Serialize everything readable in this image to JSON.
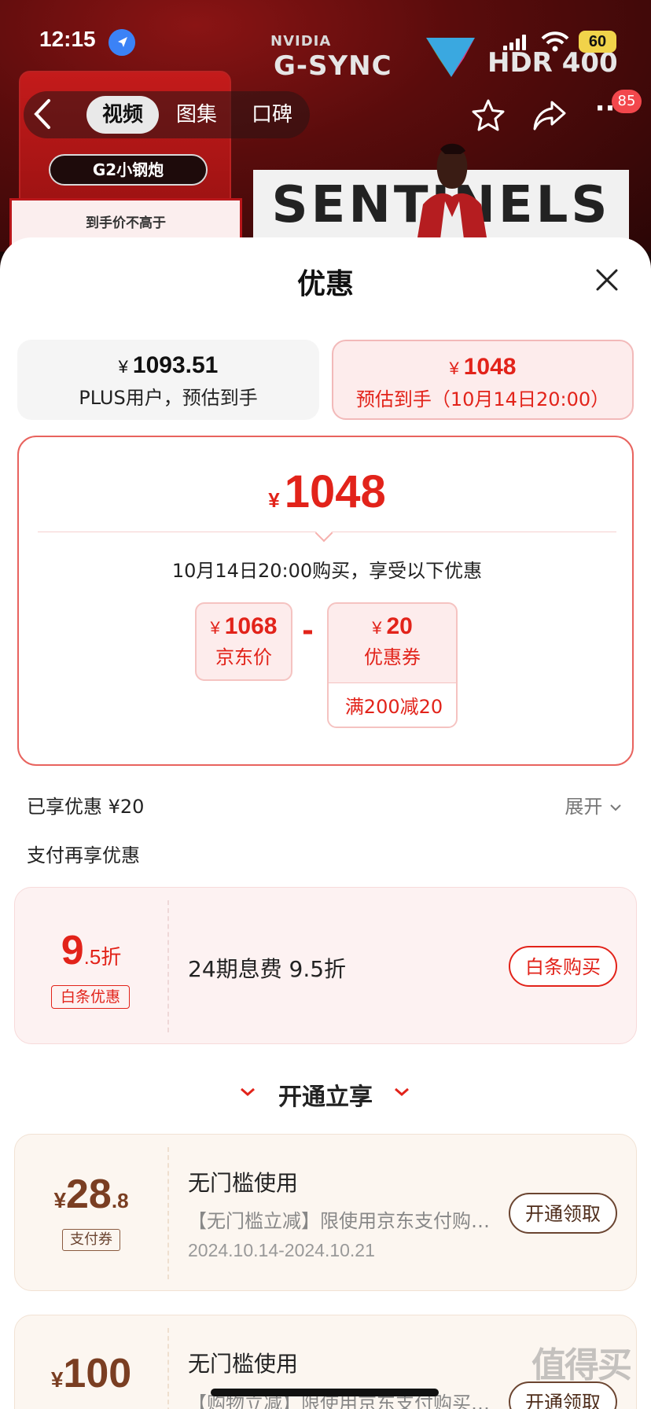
{
  "status_bar": {
    "time": "12:15",
    "battery": "60"
  },
  "banner": {
    "brand_nvidia": "NVIDIA",
    "brand_gsync": "G-SYNC",
    "brand_hdr": "HDR 400",
    "promo_name": "G2小钢炮",
    "promo_paper": "到手价不高于",
    "poster_text": "SENTINELS"
  },
  "nav": {
    "tabs": [
      {
        "label": "视频",
        "active": true
      },
      {
        "label": "图集",
        "active": false
      },
      {
        "label": "口碑",
        "active": false
      }
    ],
    "more_badge": "85"
  },
  "sheet": {
    "title": "优惠",
    "options": [
      {
        "currency": "¥",
        "price": "1093.51",
        "sub": "PLUS用户，预估到手"
      },
      {
        "currency": "¥",
        "price": "1048",
        "sub": "预估到手（10月14日20:00）"
      }
    ],
    "summary": {
      "currency": "¥",
      "price": "1048",
      "note": "10月14日20:00购买，享受以下优惠",
      "jd_price": {
        "currency": "¥",
        "value": "1068",
        "label": "京东价"
      },
      "minus": "-",
      "coupon": {
        "currency": "¥",
        "value": "20",
        "label": "优惠券",
        "condition": "满200减20"
      }
    },
    "enjoyed": "已享优惠 ¥20",
    "expand": "展开",
    "pay_more": "支付再享优惠",
    "baitiao": {
      "rate_main": "9",
      "rate_sub": ".5折",
      "tag": "白条优惠",
      "desc": "24期息费 9.5折",
      "button": "白条购买"
    },
    "section_title": "开通立享",
    "coupons": [
      {
        "currency": "¥",
        "amount": "28",
        "decimal": ".8",
        "tag": "支付券",
        "title": "无门槛使用",
        "desc": "【无门槛立减】限使用京东支付购买指定商品",
        "date": "2024.10.14-2024.10.21",
        "button": "开通领取"
      },
      {
        "currency": "¥",
        "amount": "100",
        "decimal": "",
        "title": "无门槛使用",
        "desc": "【购物立减】限使用京东支付购买指定商品",
        "button": "开通领取"
      }
    ]
  },
  "watermark": "值得买",
  "colors": {
    "accent_red": "#e2231a",
    "coupon_brown": "#7a3e22"
  }
}
